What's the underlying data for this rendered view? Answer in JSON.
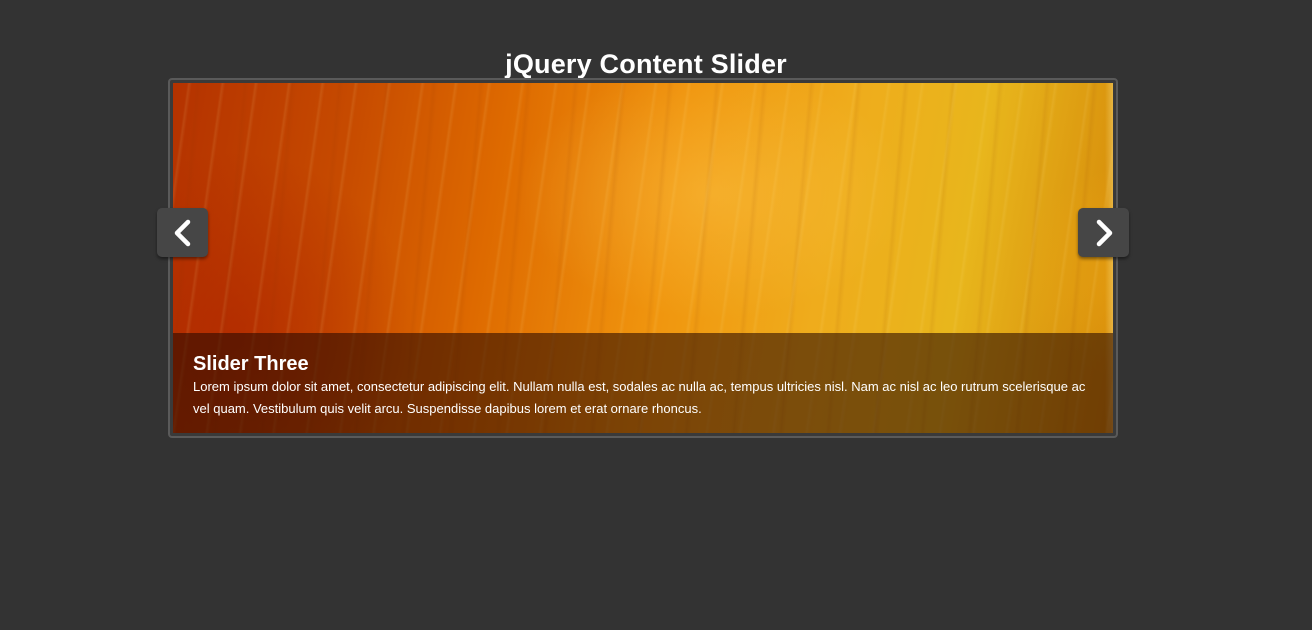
{
  "header": {
    "title": "jQuery Content Slider"
  },
  "slider": {
    "current_slide": {
      "title": "Slider Three",
      "text": "Lorem ipsum dolor sit amet, consectetur adipiscing elit. Nullam nulla est, sodales ac nulla ac, tempus ultricies nisl. Nam ac nisl ac leo rutrum scelerisque ac vel quam. Vestibulum quis velit arcu. Suspendisse dapibus lorem et erat ornare rhoncus."
    },
    "prev_icon": "chevron-left-icon",
    "next_icon": "chevron-right-icon"
  },
  "colors": {
    "page_background": "#333333",
    "arrow_background": "#464646",
    "frame_border": "#5a5a5a",
    "text": "#ffffff"
  }
}
